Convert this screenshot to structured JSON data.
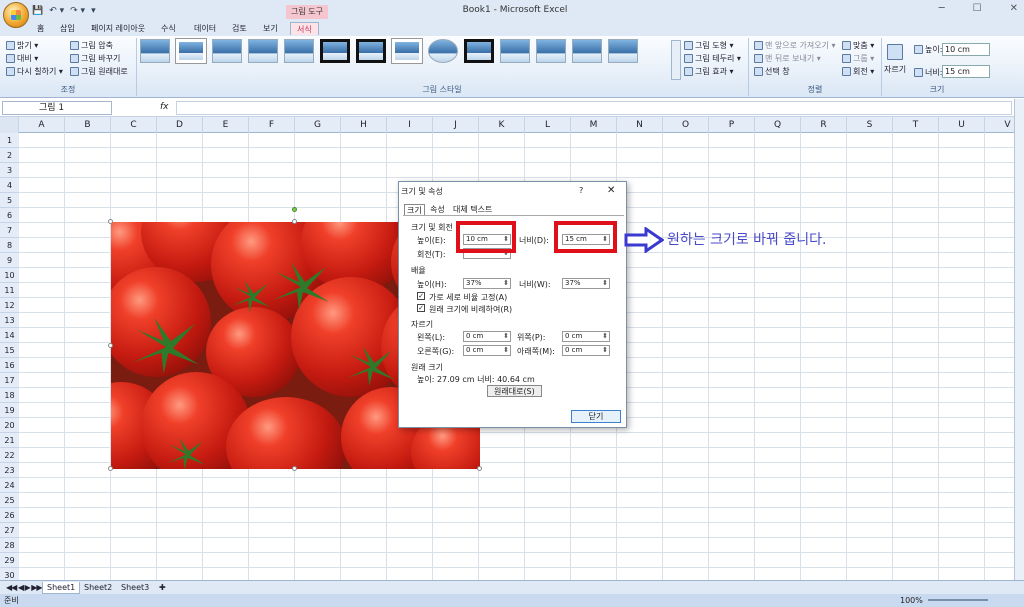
{
  "window": {
    "title": "Book1 - Microsoft Excel",
    "controls": [
      "─",
      "☐",
      "✕"
    ],
    "tool_tab_header": "그림 도구",
    "qat_items": [
      "💾",
      "↶ ▾",
      "↷ ▾",
      "▾"
    ]
  },
  "tabs": [
    "홈",
    "삽입",
    "페이지 레이아웃",
    "수식",
    "데이터",
    "검토",
    "보기",
    "서식"
  ],
  "ribbon": {
    "adjust": {
      "label": "조정",
      "items": [
        "밝기 ▾",
        "대비 ▾",
        "다시 칠하기 ▾",
        "그림 압축",
        "그림 바꾸기",
        "그림 원래대로"
      ]
    },
    "styles": {
      "label": "그림 스타일",
      "shape": "그림 도형 ▾",
      "border": "그림 테두리 ▾",
      "effect": "그림 효과 ▾"
    },
    "arrange": {
      "label": "정렬",
      "front": "맨 앞으로 가져오기 ▾",
      "back": "맨 뒤로 보내기 ▾",
      "pane": "선택 창",
      "align": "맞춤 ▾",
      "group": "그룹 ▾",
      "rotate": "회전 ▾"
    },
    "size": {
      "label": "크기",
      "crop": "자르기",
      "height_label": "높이:",
      "height": "10 cm",
      "width_label": "너비:",
      "width": "15 cm"
    }
  },
  "formula_bar": {
    "name_box": "그림 1",
    "fx": "fx"
  },
  "columns": [
    "A",
    "B",
    "C",
    "D",
    "E",
    "F",
    "G",
    "H",
    "I",
    "J",
    "K",
    "L",
    "M",
    "N",
    "O",
    "P",
    "Q",
    "R",
    "S",
    "T",
    "U",
    "V"
  ],
  "rows": [
    "1",
    "2",
    "3",
    "4",
    "5",
    "6",
    "7",
    "8",
    "9",
    "10",
    "11",
    "12",
    "13",
    "14",
    "15",
    "16",
    "17",
    "18",
    "19",
    "20",
    "21",
    "22",
    "23",
    "24",
    "25",
    "26",
    "27",
    "28",
    "29",
    "30"
  ],
  "sheets": [
    "Sheet1",
    "Sheet2",
    "Sheet3"
  ],
  "sheet_nav": "◀◀ ◀ ▶ ▶▶",
  "status": {
    "ready": "준비",
    "zoom": "100%"
  },
  "dialog": {
    "title": "크기 및 속성",
    "help": "?",
    "close": "✕",
    "tabs": [
      "크기",
      "속성",
      "대체 텍스트"
    ],
    "section_size": "크기 및 회전",
    "height_label": "높이(E):",
    "height": "10 cm",
    "width_label": "너비(D):",
    "width": "15 cm",
    "rotate_label": "회전(T):",
    "section_scale": "배율",
    "scale_h_label": "높이(H):",
    "scale_h": "37%",
    "scale_w_label": "너비(W):",
    "scale_w": "37%",
    "lock_ratio": "가로 세로 비율 고정(A)",
    "relative": "원래 크기에 비례하여(R)",
    "section_crop": "자르기",
    "left_label": "왼쪽(L):",
    "left": "0 cm",
    "top_label": "위쪽(P):",
    "top": "0 cm",
    "right_label": "오른쪽(G):",
    "right": "0 cm",
    "bottom_label": "아래쪽(M):",
    "bottom": "0 cm",
    "section_orig": "원래 크기",
    "orig_text": "높이:   27.09 cm   너비:   40.64 cm",
    "reset": "원래대로(S)",
    "close_btn": "닫기"
  },
  "annotation": "원하는 크기로 바꿔 줍니다."
}
